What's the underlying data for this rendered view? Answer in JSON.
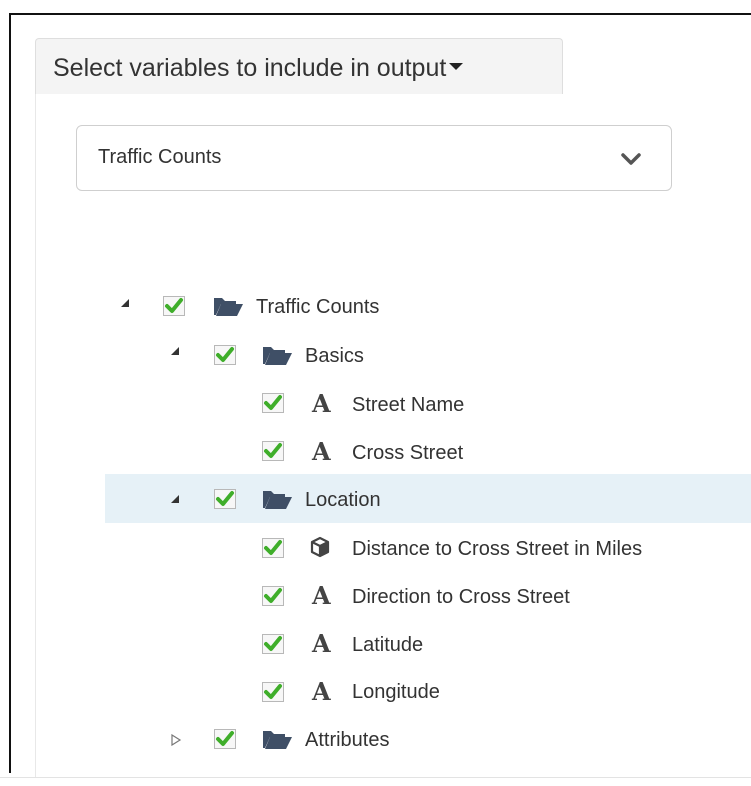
{
  "header": {
    "tab_label": "Select variables to include in output"
  },
  "dataset_select": {
    "value": "Traffic Counts",
    "icon": "chevron-down-icon"
  },
  "tree": {
    "root": {
      "label": "Traffic Counts",
      "expanded": true,
      "checked": true,
      "icon": "folder-open-icon"
    },
    "basics": {
      "label": "Basics",
      "expanded": true,
      "checked": true,
      "icon": "folder-open-icon",
      "items": [
        {
          "label": "Street Name",
          "type_icon": "text-type-icon",
          "glyph": "A",
          "checked": true
        },
        {
          "label": "Cross Street",
          "type_icon": "text-type-icon",
          "glyph": "A",
          "checked": true
        }
      ]
    },
    "location": {
      "label": "Location",
      "expanded": true,
      "checked": true,
      "selected": true,
      "icon": "folder-open-icon",
      "items": [
        {
          "label": "Distance to Cross Street in Miles",
          "type_icon": "numeric-cube-icon",
          "checked": true
        },
        {
          "label": "Direction to Cross Street",
          "type_icon": "text-type-icon",
          "glyph": "A",
          "checked": true
        },
        {
          "label": "Latitude",
          "type_icon": "text-type-icon",
          "glyph": "A",
          "checked": true
        },
        {
          "label": "Longitude",
          "type_icon": "text-type-icon",
          "glyph": "A",
          "checked": true
        }
      ]
    },
    "attributes": {
      "label": "Attributes",
      "expanded": false,
      "checked": true,
      "icon": "folder-open-icon"
    }
  },
  "colors": {
    "check_green": "#3fae2a",
    "folder_slate": "#3f4f66",
    "selected_row": "#e6f1f7"
  }
}
